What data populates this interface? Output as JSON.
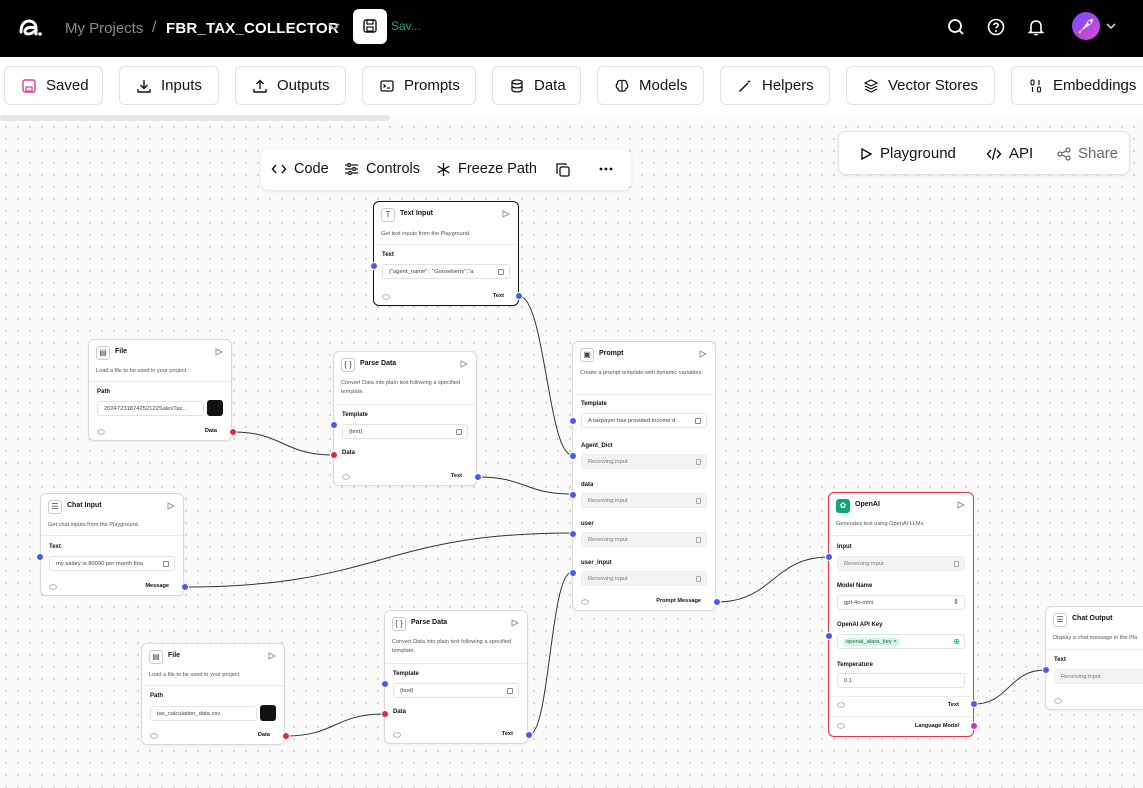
{
  "header": {
    "breadcrumb_projects": "My Projects",
    "breadcrumb_sep": "/",
    "project_name": "FBR_TAX_COLLECTOR",
    "save_status": "Sav..."
  },
  "toolbar": {
    "saved": "Saved",
    "inputs": "Inputs",
    "outputs": "Outputs",
    "prompts": "Prompts",
    "data": "Data",
    "models": "Models",
    "helpers": "Helpers",
    "vector_stores": "Vector Stores",
    "embeddings": "Embeddings"
  },
  "playground_panel": {
    "playground": "Playground",
    "api": "API",
    "share": "Share"
  },
  "node_toolbar": {
    "code": "Code",
    "controls": "Controls",
    "freeze_path": "Freeze Path"
  },
  "nodes": {
    "text_input": {
      "title": "Text Input",
      "desc": "Get text inputs from the Playground.",
      "field_label": "Text",
      "field_value": "{\"agent_name\" : \"Gooseberry\",\"a",
      "output": "Text"
    },
    "file1": {
      "title": "File",
      "desc": "Load a file to be used in your project.",
      "field_label": "Path",
      "field_value": "20247231874252122SalesTax...",
      "output": "Data"
    },
    "parse1": {
      "title": "Parse Data",
      "desc": "Convert Data into plain text following a specified template.",
      "template_label": "Template",
      "template_value": "{text}",
      "data_label": "Data",
      "output": "Text"
    },
    "prompt": {
      "title": "Prompt",
      "desc": "Create a prompt template with dynamic variables.",
      "template_label": "Template",
      "template_value": "A taxpayer has provided income d",
      "var1": "Agent_Dict",
      "var2": "data",
      "var3": "user",
      "var4": "user_input",
      "receiving": "Receiving input",
      "output": "Prompt Message"
    },
    "chat_input": {
      "title": "Chat Input",
      "desc": "Get chat inputs from the Playground.",
      "field_label": "Text",
      "field_value": "my salary is 80000 per month fina",
      "output": "Message"
    },
    "openai": {
      "title": "OpenAI",
      "desc": "Generates text using OpenAI LLMs.",
      "input_label": "Input",
      "input_value": "Receiving input",
      "model_label": "Model Name",
      "model_value": "gpt-4o-mini",
      "key_label": "OpenAI API Key",
      "key_value": "openai_alara_key",
      "temp_label": "Temperature",
      "temp_value": "0.1",
      "out_text": "Text",
      "out_model": "Language Model"
    },
    "file2": {
      "title": "File",
      "desc": "Load a file to be used in your project.",
      "field_label": "Path",
      "field_value": "tax_calculation_data.csv",
      "output": "Data"
    },
    "parse2": {
      "title": "Parse Data",
      "desc": "Convert Data into plain text following a specified template.",
      "template_label": "Template",
      "template_value": "{text}",
      "data_label": "Data",
      "output": "Text"
    },
    "chat_output": {
      "title": "Chat Output",
      "desc": "Display a chat message in the Pla",
      "field_label": "Text",
      "field_value": "Receiving input"
    }
  }
}
